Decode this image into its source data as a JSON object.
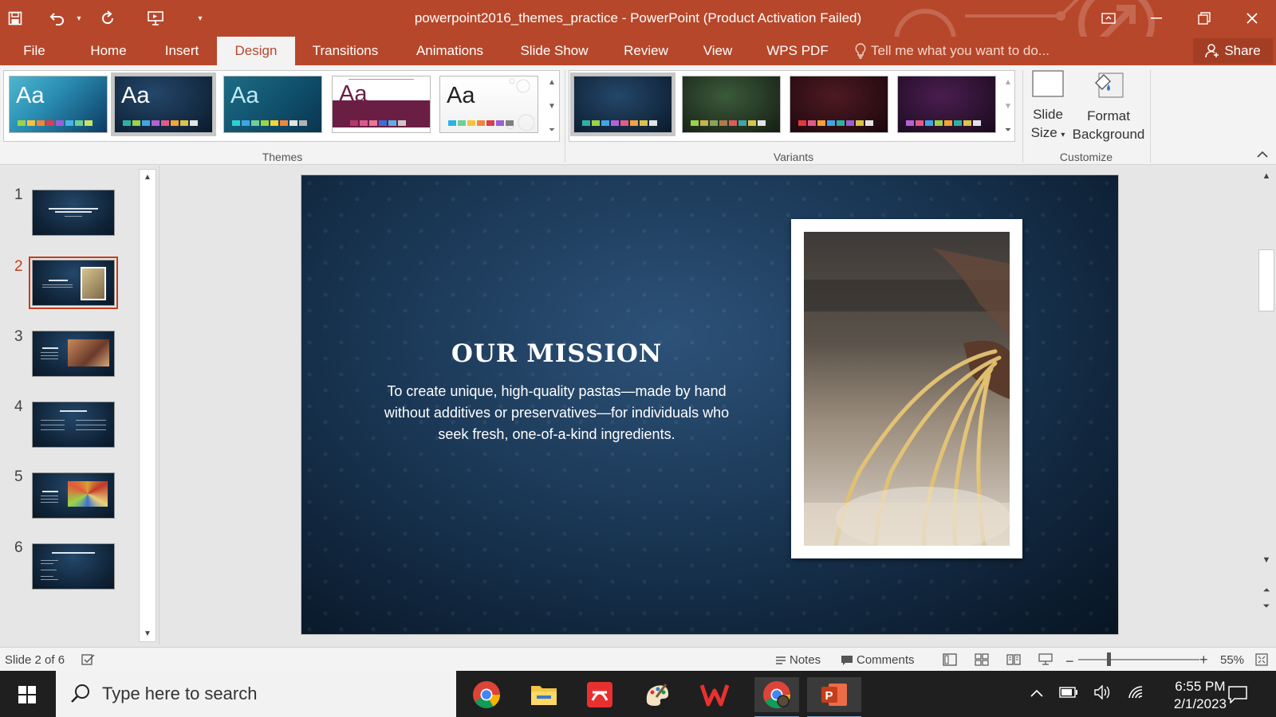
{
  "window": {
    "title": "powerpoint2016_themes_practice - PowerPoint (Product Activation Failed)"
  },
  "tabs": [
    {
      "label": "File"
    },
    {
      "label": "Home"
    },
    {
      "label": "Insert"
    },
    {
      "label": "Design"
    },
    {
      "label": "Transitions"
    },
    {
      "label": "Animations"
    },
    {
      "label": "Slide Show"
    },
    {
      "label": "Review"
    },
    {
      "label": "View"
    },
    {
      "label": "WPS PDF"
    }
  ],
  "active_tab": "Design",
  "tell_me": "Tell me what you want to do...",
  "share_label": "Share",
  "ribbon": {
    "themes_label": "Themes",
    "variants_label": "Variants",
    "customize_label": "Customize",
    "theme_sample_text": "Aa",
    "slide_size_line1": "Slide",
    "slide_size_line2": "Size",
    "format_bg_line1": "Format",
    "format_bg_line2": "Background"
  },
  "colors": {
    "accent": "#b7472a",
    "slide_bg": "#1a3755",
    "current_slide_outline": "#c43e1c"
  },
  "slides": [
    {
      "num": "1"
    },
    {
      "num": "2"
    },
    {
      "num": "3"
    },
    {
      "num": "4"
    },
    {
      "num": "5"
    },
    {
      "num": "6"
    }
  ],
  "current_slide": {
    "title": "OUR MISSION",
    "body": "To create unique, high-quality pastas—made by hand without additives or preservatives—for individuals who seek fresh, one-of-a-kind ingredients."
  },
  "status": {
    "slide_indicator": "Slide 2 of 6",
    "notes": "Notes",
    "comments": "Comments",
    "zoom": "55%"
  },
  "taskbar": {
    "search_placeholder": "Type here to search",
    "time": "6:55 PM",
    "date": "2/1/2023"
  }
}
